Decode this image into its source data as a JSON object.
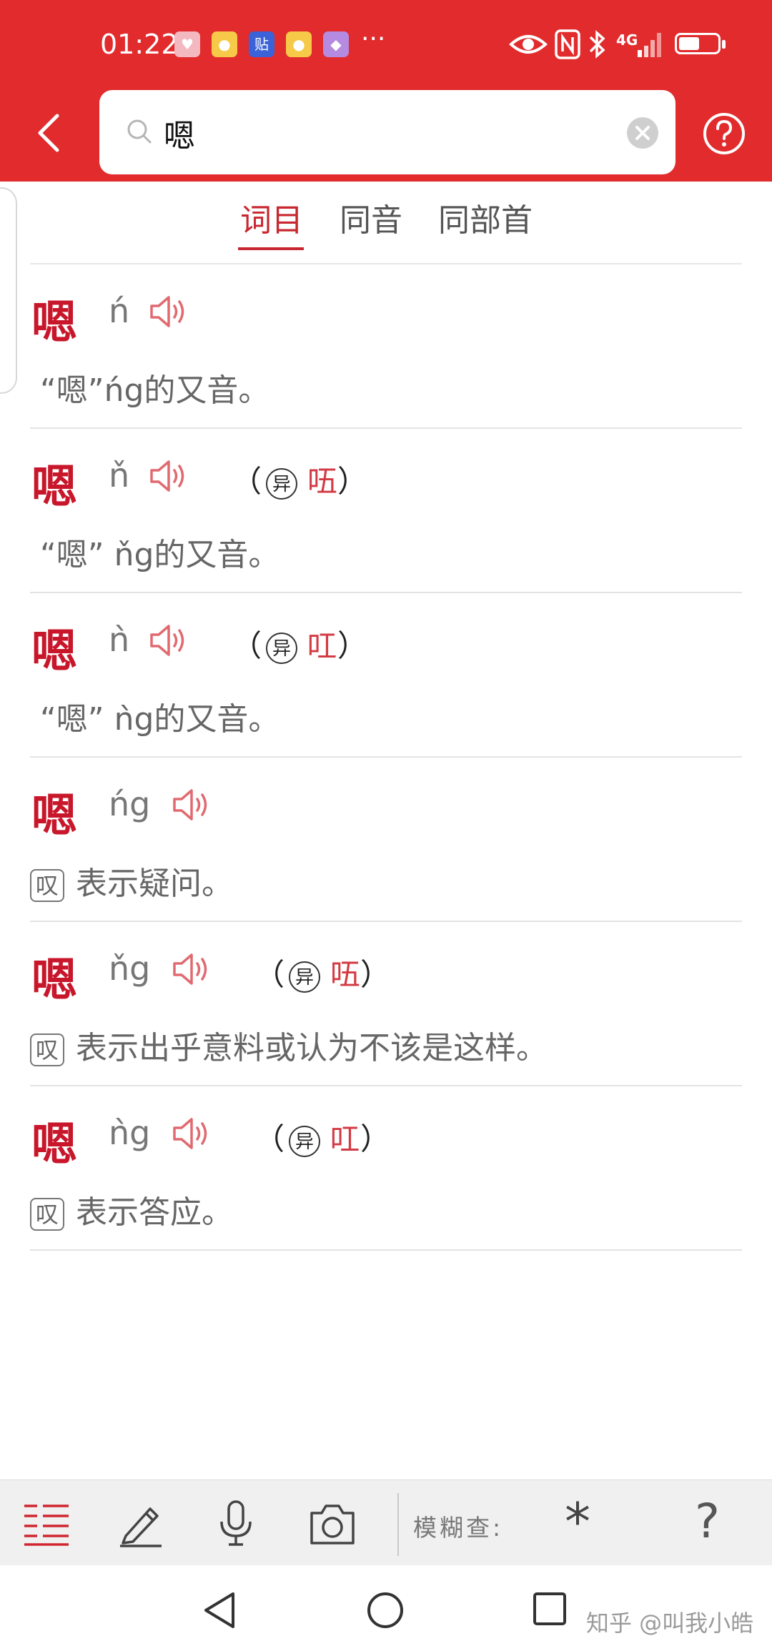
{
  "status_bar": {
    "time": "01:22",
    "notification_icons": [
      "heart-app-icon",
      "weibo-icon",
      "tieba-icon",
      "weibo-icon",
      "browser-icon"
    ],
    "tieba_glyph": "贴",
    "more": "···",
    "network": "4G",
    "signal_icons": [
      "eye-icon",
      "nfc-icon",
      "bluetooth-icon",
      "signal-icon",
      "battery-icon"
    ]
  },
  "header": {
    "search_value": "嗯",
    "background_color": "#e12b2d"
  },
  "tabs": [
    {
      "label": "词目",
      "active": true
    },
    {
      "label": "同音",
      "active": false
    },
    {
      "label": "同部首",
      "active": false
    }
  ],
  "entries": [
    {
      "char": "嗯",
      "pinyin": "ń",
      "definition": "“嗯”ńg的又音。"
    },
    {
      "char": "嗯",
      "pinyin": "ň",
      "variant_open": "（",
      "variant_mark": "异",
      "variant_char": "㕶",
      "variant_close": "）",
      "definition": "“嗯” ňg的又音。"
    },
    {
      "char": "嗯",
      "pinyin": "ǹ",
      "variant_open": "（",
      "variant_mark": "异",
      "variant_char": "叿",
      "variant_close": "）",
      "definition": "“嗯” ǹg的又音。"
    },
    {
      "char": "嗯",
      "pinyin": "ńg",
      "tag": "叹",
      "definition": "表示疑问。"
    },
    {
      "char": "嗯",
      "pinyin": "ňg",
      "variant_open": "（",
      "variant_mark": "异",
      "variant_char": "㕶",
      "variant_close": "）",
      "tag": "叹",
      "definition": "表示出乎意料或认为不该是这样。"
    },
    {
      "char": "嗯",
      "pinyin": "ǹg",
      "variant_open": "（",
      "variant_mark": "异",
      "variant_char": "叿",
      "variant_close": "）",
      "tag": "叹",
      "definition": "表示答应。"
    }
  ],
  "toolbar": {
    "fuzzy_label": "模糊查:",
    "wildcard": "*",
    "question": "?"
  },
  "navbar": {
    "watermark": "知乎 @叫我小皓"
  },
  "colors": {
    "accent": "#c8172b",
    "variant": "#d33b44",
    "speaker": "#e06a70"
  }
}
